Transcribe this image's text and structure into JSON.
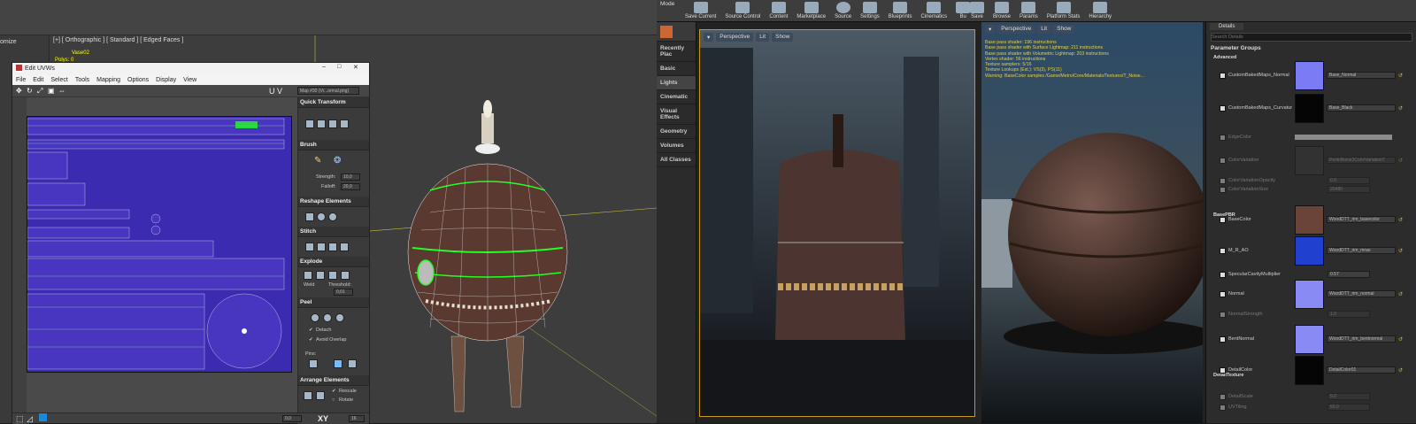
{
  "max": {
    "viewport_label": "[+] [ Orthographic ] [ Standard ] [ Edged Faces ]",
    "object_name": "Vase02",
    "object_info": "Polys: 0",
    "cmd_label": "omize",
    "uvw": {
      "title": "Edit UVWs",
      "menu": [
        "File",
        "Edit",
        "Select",
        "Tools",
        "Mapping",
        "Options",
        "Display",
        "View"
      ],
      "map_dropdown": "Map #30 (Vr...ormal.png)",
      "uv_label": "U V",
      "quick_transform": "Quick Transform",
      "brush": "Brush",
      "strength_label": "Strength:",
      "strength_value": "10,0",
      "falloff_label": "Falloff:",
      "falloff_value": "20,0",
      "reshape": "Reshape Elements",
      "stitch": "Stitch",
      "explode": "Explode",
      "weld_label": "Weld",
      "threshold_label": "Threshold:",
      "threshold_value": "0,01",
      "peel": "Peel",
      "detach_label": "Detach",
      "avoid_overlap_label": "Avoid Overlap",
      "pins_label": "Pins:",
      "arrange": "Arrange Elements",
      "rescale_label": "Rescale",
      "rotate_label": "Rotate",
      "coord_u": "0,0",
      "xy_label": "XY",
      "grid_value": "16"
    }
  },
  "ue": {
    "mode_tab": "Mode",
    "toolbar": [
      "Save Current",
      "Source Control",
      "Content",
      "Marketplace",
      "Source",
      "Settings",
      "Blueprints",
      "Cinematics",
      "Bu"
    ],
    "toolbar2": [
      "Save",
      "Browse",
      "Params",
      "Platform Stats",
      "Hierarchy"
    ],
    "modes": [
      "Recently Plac",
      "Basic",
      "Lights",
      "Cinematic",
      "Visual Effects",
      "Geometry",
      "Volumes",
      "All Classes"
    ],
    "vp1_buttons": [
      "Perspective",
      "Lit",
      "Show"
    ],
    "vp2_buttons": [
      "Perspective",
      "Lit",
      "Show"
    ],
    "stats": [
      "Base pass shader: 196 instructions",
      "Base pass shader with Surface Lightmap: 211 instructions",
      "Base pass shader with Volumetric Lightmap: 203 instructions",
      "Vertex shader: 56 instructions",
      "Texture samplers: 5/16",
      "Texture Lookups (Est.): VS(3), PS(11)",
      "Warning: BaseColor samples /Game/Metro/Core/Materials/Textures/T_Noise..."
    ],
    "details": {
      "tab": "Details",
      "search_placeholder": "Search Details",
      "param_groups": "Parameter Groups",
      "advanced": "Advanced",
      "basepbr": "BasePBR",
      "detail_texture": "DetailTexture",
      "params": [
        {
          "label": "CustomBakedMaps_Normal",
          "value": "Base_Normal",
          "color": "#7b7bf5",
          "active": true
        },
        {
          "label": "CustomBakedMaps_Curvatur",
          "value": "Base_Black",
          "color": "#050505",
          "active": true
        },
        {
          "label": "EdgeColor",
          "value": "",
          "color": "#ffffff",
          "active": false
        },
        {
          "label": "ColorVariation",
          "value": "PerlinNoise3ColorVariationT",
          "color": "#3a3a3a",
          "active": false
        },
        {
          "label": "ColorVariationOpacity",
          "value": "0.0",
          "color": "",
          "active": false
        },
        {
          "label": "ColorVariationSize",
          "value": "20480",
          "color": "",
          "active": false
        },
        {
          "label": "BaseColor",
          "value": "WoodDTT_rim_basecolor",
          "color": "#6a4438",
          "active": true
        },
        {
          "label": "M_R_AO",
          "value": "WoodDTT_rim_mrao",
          "color": "#2040d0",
          "active": true
        },
        {
          "label": "SpecularCavityMultiplier",
          "value": "0.57",
          "color": "",
          "active": true
        },
        {
          "label": "Normal",
          "value": "WoodDTT_rim_normal",
          "color": "#8a8af5",
          "active": true
        },
        {
          "label": "NormalStrength",
          "value": "1.0",
          "color": "",
          "active": false
        },
        {
          "label": "BentNormal",
          "value": "WoodDTT_rim_bentnormal",
          "color": "#8a8af5",
          "active": true
        },
        {
          "label": "DetailColor",
          "value": "DetailColor01",
          "color": "#050505",
          "active": true
        },
        {
          "label": "DetailScale",
          "value": "5.0",
          "color": "",
          "active": false
        },
        {
          "label": "UVTiling",
          "value": "50.0",
          "color": "",
          "active": false
        }
      ]
    }
  }
}
